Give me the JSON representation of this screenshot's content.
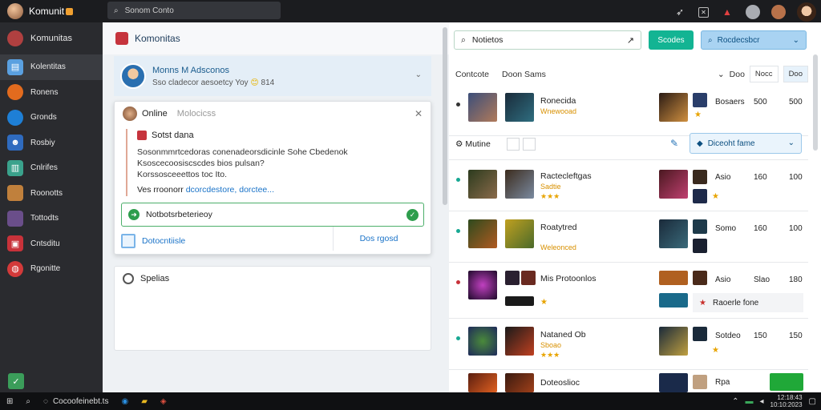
{
  "app": {
    "title": "Komunit",
    "search_placeholder": "Sonom Conto",
    "top_icons": [
      "rocket-icon",
      "x-icon",
      "flame-icon",
      "user-icon",
      "settings-icon",
      "avatar"
    ]
  },
  "sidebar": {
    "items": [
      {
        "label": "Komunitas",
        "icon": "avatar",
        "color": "#b04040"
      },
      {
        "label": "Kolentitas",
        "icon": "document-icon",
        "color": "#5aa0e0"
      },
      {
        "label": "Ronens",
        "icon": "firefox-icon",
        "color": "#e26b1e"
      },
      {
        "label": "Gronds",
        "icon": "edge-icon",
        "color": "#1e7fd6"
      },
      {
        "label": "Rosbiy",
        "icon": "person-icon",
        "color": "#2f6bbf"
      },
      {
        "label": "Cnlrifes",
        "icon": "files-icon",
        "color": "#3aa28c"
      },
      {
        "label": "Roonotts",
        "icon": "game-icon",
        "color": "#c0803c"
      },
      {
        "label": "Tottodts",
        "icon": "character-icon",
        "color": "#6a4e8a"
      },
      {
        "label": "Cntsditu",
        "icon": "book-icon",
        "color": "#c8323a"
      },
      {
        "label": "Rgonitte",
        "icon": "globe-icon",
        "color": "#d33a3a"
      }
    ]
  },
  "left": {
    "header": "Komonitas",
    "profile": {
      "name": "Monns M Adsconos",
      "sub": "Sso cladecor aesoetcy Yoy",
      "emoji": "😊",
      "count": "814"
    },
    "popup": {
      "status": "Online",
      "status_muted": "Molocicss",
      "msg_title": "Sotst dana",
      "lines": [
        "Sosonmmrtcedoras conenadeorsdicinle Sohe Cbedenok",
        "Ksoscecoosiscscdes bios pulsan?",
        "Korssosceeettos toc Ito."
      ],
      "last_text": "Ves rroonorr",
      "last_link": "dcorcdestore, dorctee...",
      "check_label": "Notbotsrbeterieoy",
      "footer_link": "Dotocntiisle",
      "footer_button": "Dos rgosd"
    },
    "settings_title": "Spelias"
  },
  "right": {
    "search_value": "Notietos",
    "green_button": "Scodes",
    "blue_button": "Rocdecsbcr",
    "tabs": [
      "Contcote",
      "Doon Sams"
    ],
    "tab_right": [
      "Doo",
      "Nocc",
      "Doo"
    ],
    "rows": [
      {
        "title": "Ronecida",
        "sub": "Wnewooad",
        "c1": "Bosaers",
        "c2": "500",
        "c3": "500"
      },
      {
        "title": "Ractecleftgas",
        "sub": "Sadtie",
        "c1": "Asio",
        "c2": "160",
        "c3": "100"
      },
      {
        "title": "Roatytred",
        "sub": "Weleonced",
        "c1": "Somo",
        "c2": "160",
        "c3": "100"
      },
      {
        "title": "Mis Protoonlos",
        "sub": "",
        "c1": "Asio",
        "c2": "Slao",
        "c3": "180"
      },
      {
        "title": "Nataned Ob",
        "sub": "Sboao",
        "c1": "Sotdeo",
        "c2": "150",
        "c3": "150"
      },
      {
        "title": "Doteoslioc",
        "sub": "",
        "c1": "Rpa",
        "c2": "",
        "c3": ""
      }
    ],
    "mid_label": "Mutine",
    "mid_dropdown": "Diceoht fame",
    "highlight_text": "Raoerle fone"
  },
  "taskbar": {
    "search_text": "Cocoofeinebt.ts",
    "time": "12:18:43",
    "date": "10:10:2023"
  }
}
